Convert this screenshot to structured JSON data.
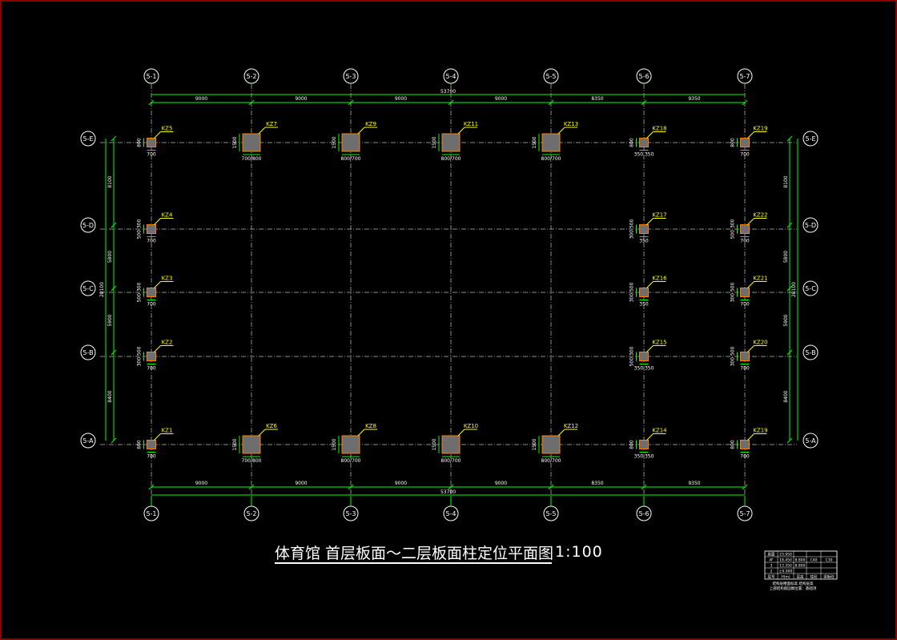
{
  "drawing": {
    "title": "体育馆 首层板面～二层板面柱定位平面图",
    "scale": "1:100",
    "total_dim": "53700"
  },
  "axes_x": [
    "5-1",
    "5-2",
    "5-3",
    "5-4",
    "5-5",
    "5-6",
    "5-7"
  ],
  "axes_y": [
    "5-E",
    "5-D",
    "5-C",
    "5-B",
    "5-A"
  ],
  "spans_x": [
    "9000",
    "9000",
    "9000",
    "9000",
    "8350",
    "9350"
  ],
  "spans_y_left": [
    "8100",
    "5800",
    "5900",
    "8400"
  ],
  "spans_y_right": [
    "8100",
    "5800",
    "5900",
    "8400"
  ],
  "overall_y": "28100",
  "columns": [
    {
      "id": "KZ5",
      "xi": 0,
      "yi": 0,
      "big": false,
      "w": "700",
      "h": "800"
    },
    {
      "id": "KZ7",
      "xi": 1,
      "yi": 0,
      "big": true,
      "w": "700/800",
      "h": "1500"
    },
    {
      "id": "KZ9",
      "xi": 2,
      "yi": 0,
      "big": true,
      "w": "800/700",
      "h": "1500"
    },
    {
      "id": "KZ11",
      "xi": 3,
      "yi": 0,
      "big": true,
      "w": "800/700",
      "h": "1500"
    },
    {
      "id": "KZ13",
      "xi": 4,
      "yi": 0,
      "big": true,
      "w": "800/700",
      "h": "1500"
    },
    {
      "id": "KZ18",
      "xi": 5,
      "yi": 0,
      "big": false,
      "w": "350  350",
      "h": "800"
    },
    {
      "id": "KZ19",
      "xi": 6,
      "yi": 0,
      "big": false,
      "w": "700",
      "h": "800"
    },
    {
      "id": "KZ4",
      "xi": 0,
      "yi": 1,
      "big": false,
      "w": "700",
      "h": "500 300"
    },
    {
      "id": "KZ17",
      "xi": 5,
      "yi": 1,
      "big": false,
      "w": "350",
      "h": "300 500"
    },
    {
      "id": "KZ22",
      "xi": 6,
      "yi": 1,
      "big": false,
      "w": "700",
      "h": "500 300"
    },
    {
      "id": "KZ3",
      "xi": 0,
      "yi": 2,
      "big": false,
      "w": "700",
      "h": "500 300"
    },
    {
      "id": "KZ16",
      "xi": 5,
      "yi": 2,
      "big": false,
      "w": "350",
      "h": "300 500"
    },
    {
      "id": "KZ21",
      "xi": 6,
      "yi": 2,
      "big": false,
      "w": "700",
      "h": "300 500"
    },
    {
      "id": "KZ2",
      "xi": 0,
      "yi": 3,
      "big": false,
      "w": "700",
      "h": "300 500"
    },
    {
      "id": "KZ15",
      "xi": 5,
      "yi": 3,
      "big": false,
      "w": "350  350",
      "h": "500 300"
    },
    {
      "id": "KZ20",
      "xi": 6,
      "yi": 3,
      "big": false,
      "w": "700",
      "h": "300 500"
    },
    {
      "id": "KZ1",
      "xi": 0,
      "yi": 4,
      "big": false,
      "w": "700",
      "h": "800"
    },
    {
      "id": "KZ6",
      "xi": 1,
      "yi": 4,
      "big": true,
      "w": "700/800",
      "h": "1500"
    },
    {
      "id": "KZ8",
      "xi": 2,
      "yi": 4,
      "big": true,
      "w": "800/700",
      "h": "1500"
    },
    {
      "id": "KZ10",
      "xi": 3,
      "yi": 4,
      "big": true,
      "w": "800/700",
      "h": "1500"
    },
    {
      "id": "KZ12",
      "xi": 4,
      "yi": 4,
      "big": true,
      "w": "800/700",
      "h": "1500"
    },
    {
      "id": "KZ14",
      "xi": 5,
      "yi": 4,
      "big": false,
      "w": "350  350",
      "h": "800"
    },
    {
      "id": "KZ19",
      "xi": 6,
      "yi": 4,
      "big": false,
      "w": "700",
      "h": "800"
    }
  ],
  "legend_table": {
    "rows": [
      [
        "屋面",
        "23.950",
        "",
        "",
        ""
      ],
      [
        "4F",
        "18.450",
        "8.800",
        "C40",
        "C30"
      ],
      [
        "3",
        "13.350",
        "8.800",
        "",
        ""
      ],
      [
        "2",
        "±0.000",
        "",
        "",
        ""
      ],
      [
        "层号",
        "H(m)",
        "层高",
        "柱砼",
        "梁板砼"
      ]
    ],
    "note1": "结构层楼面标高 结构层高",
    "note2": "上部结构嵌固端位置：基础顶"
  },
  "colors": {
    "background": "#000000",
    "grid": "#8a8a8a",
    "dim": "#00ff00",
    "axis_bubble": "#ffffff",
    "column_fill": "#6e6e6e",
    "column_edge": "#ff8000",
    "label": "#ffff00",
    "border": "#8b0000"
  }
}
